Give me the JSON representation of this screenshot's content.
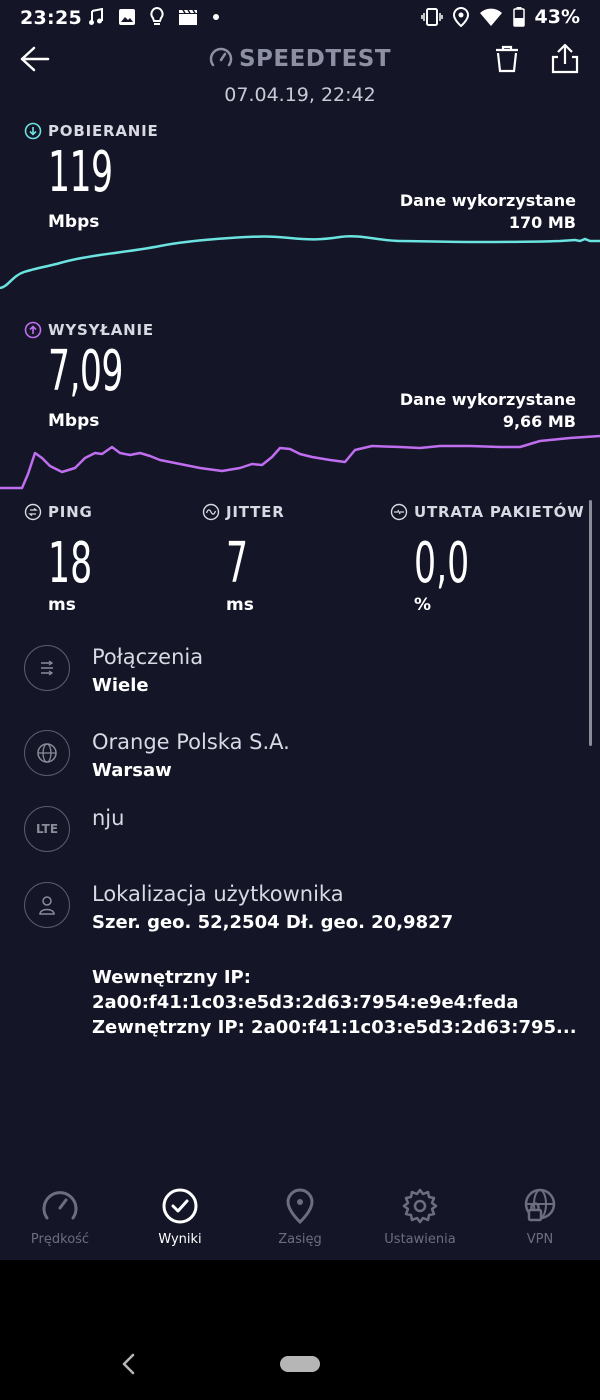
{
  "status_bar": {
    "time": "23:25",
    "battery": "43%",
    "left_icons": [
      "music-note-icon",
      "image-icon",
      "lightbulb-icon",
      "clapperboard-icon",
      "dot-icon"
    ],
    "right_icons": [
      "vibrate-icon",
      "location-icon",
      "wifi-icon",
      "battery-icon"
    ]
  },
  "header": {
    "title": "SPEEDTEST",
    "date": "07.04.19, 22:42"
  },
  "download": {
    "label": "POBIERANIE",
    "value": "119",
    "unit": "Mbps",
    "data_used_label": "Dane wykorzystane",
    "data_used_value": "170 MB",
    "color": "#6be3e0"
  },
  "upload": {
    "label": "WYSYŁANIE",
    "value": "7,09",
    "unit": "Mbps",
    "data_used_label": "Dane wykorzystane",
    "data_used_value": "9,66 MB",
    "color": "#bf6ef0"
  },
  "metrics": {
    "ping": {
      "label": "PING",
      "value": "18",
      "unit": "ms"
    },
    "jitter": {
      "label": "JITTER",
      "value": "7",
      "unit": "ms"
    },
    "packet_loss": {
      "label": "UTRATA PAKIETÓW",
      "value": "0,0",
      "unit": "%"
    }
  },
  "info": {
    "connections": {
      "title": "Połączenia",
      "value": "Wiele"
    },
    "provider": {
      "title": "Orange Polska S.A.",
      "value": "Warsaw"
    },
    "network": {
      "badge": "LTE",
      "title": "nju"
    },
    "location": {
      "title": "Lokalizacja użytkownika",
      "coords": "Szer. geo. 52,2504 Dł. geo. 20,9827",
      "internal_ip_label": "Wewnętrzny IP:",
      "internal_ip": "2a00:f41:1c03:e5d3:2d63:7954:e9e4:feda",
      "external_ip": "Zewnętrzny IP: 2a00:f41:1c03:e5d3:2d63:795..."
    }
  },
  "bottom_nav": {
    "items": [
      {
        "label": "Prędkość",
        "icon": "speedometer-icon",
        "active": false
      },
      {
        "label": "Wyniki",
        "icon": "check-circle-icon",
        "active": true
      },
      {
        "label": "Zasięg",
        "icon": "map-pin-icon",
        "active": false
      },
      {
        "label": "Ustawienia",
        "icon": "gear-icon",
        "active": false
      },
      {
        "label": "VPN",
        "icon": "vpn-globe-lock-icon",
        "active": false
      }
    ]
  }
}
